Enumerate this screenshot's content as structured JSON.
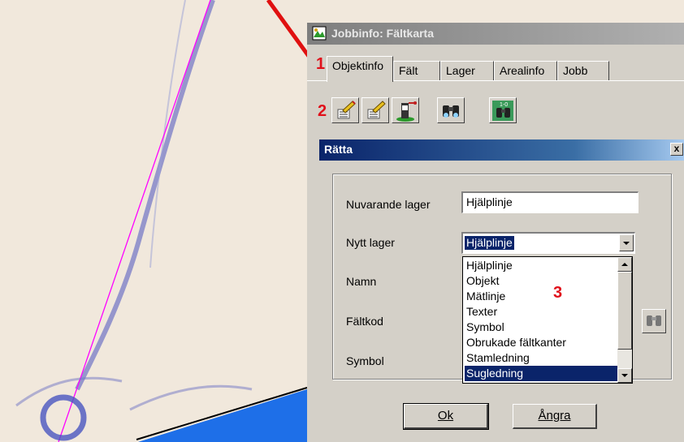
{
  "window": {
    "title": "Jobbinfo: Fältkarta"
  },
  "markers": [
    "1",
    "2",
    "3"
  ],
  "tabs": [
    "Objektinfo",
    "Fält",
    "Lager",
    "Arealinfo",
    "Jobb"
  ],
  "toolbar": {
    "icons": [
      "edit-list-icon",
      "edit-list-icon",
      "layer-tool-icon",
      "binoculars-icon",
      "binoculars-numbered-icon"
    ],
    "numbered_label": "1-0"
  },
  "dialog": {
    "title": "Rätta",
    "close": "x",
    "fields": {
      "current_layer_label": "Nuvarande lager",
      "current_layer_value": "Hjälplinje",
      "new_layer_label": "Nytt lager",
      "new_layer_value": "Hjälplinje",
      "name_label": "Namn",
      "field_code_label": "Fältkod",
      "symbol_label": "Symbol"
    },
    "dropdown_options": [
      "Hjälplinje",
      "Objekt",
      "Mätlinje",
      "Texter",
      "Symbol",
      "Obrukade fältkanter",
      "Stamledning",
      "Sugledning"
    ],
    "selected_option": "Sugledning",
    "ok_label": "Ok",
    "cancel_label": "Ångra"
  },
  "colors": {
    "marker": "#e0101a",
    "selection": "#0a246a",
    "map_line": "#ff00ff",
    "map_blue": "#1e6fe8"
  }
}
